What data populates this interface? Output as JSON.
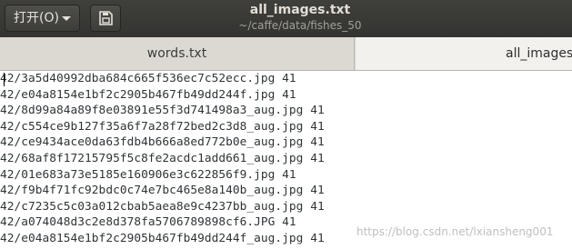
{
  "toolbar": {
    "open_label": "打开(O)",
    "save_icon": "save-icon"
  },
  "window": {
    "title": "all_images.txt",
    "subtitle": "~/caffe/data/fishes_50"
  },
  "tabs": [
    {
      "label": "words.txt",
      "active": false
    },
    {
      "label": "all_images",
      "active": true
    }
  ],
  "lines": [
    "42/3a5d40992dba684c665f536ec7c52ecc.jpg 41",
    "42/e04a8154e1bf2c2905b467fb49dd244f.jpg 41",
    "42/8d99a84a89f8e03891e55f3d741498a3_aug.jpg 41",
    "42/c554ce9b127f35a6f7a28f72bed2c3d8_aug.jpg 41",
    "42/ce9434ace0da63fdb4b666a8ed772b0e_aug.jpg 41",
    "42/68af8f17215795f5c8fe2acdc1add661_aug.jpg 41",
    "42/01e683a73e5185e160906e3c622856f9.jpg 41",
    "42/f9b4f71fc92bdc0c74e7bc465e8a140b_aug.jpg 41",
    "42/c7235c5c03a012cbab5aea8e9c4237bb_aug.jpg 41",
    "42/a074048d3c2e8d378fa5706789898cf6.JPG 41",
    "42/e04a8154e1bf2c2905b467fb49dd244f_aug.jpg 41"
  ],
  "watermark": "https://blog.csdn.net/lxiansheng001"
}
